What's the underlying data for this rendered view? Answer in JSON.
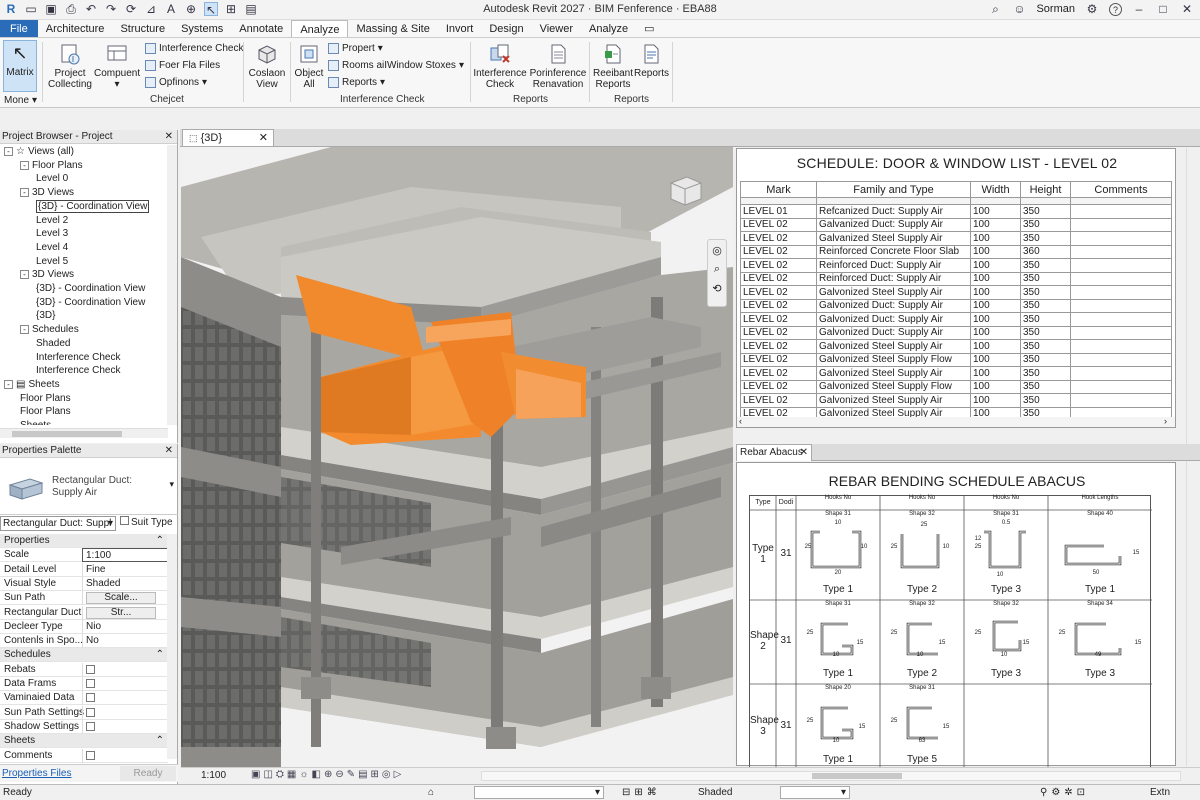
{
  "titlebar": {
    "title": "Autodesk Revit 2027 · BIM Fenference · EBA88",
    "user": "Sorman",
    "help": "?"
  },
  "menu": [
    "File",
    "Architecture",
    "Structure",
    "Systems",
    "Annotate",
    "Analyze",
    "Massing & Site",
    "Invort",
    "Design",
    "Viewer",
    "Analyze"
  ],
  "ribbon": {
    "matrix": "Matrix",
    "more": "Mone",
    "project_collecting": [
      "Project",
      "Collecting"
    ],
    "component": "Compuent",
    "interference_check_small": "Interference Check",
    "foer_fla_files": "Foer Fla Files",
    "options": "Opfinons",
    "coslaon_view": [
      "Coslaon",
      "View"
    ],
    "object_all": [
      "Object",
      "All"
    ],
    "propert": "Propert",
    "rooms": "Rooms aiIWindow Stoxes",
    "reports_small": "Reports",
    "interference_check_big": [
      "Interference",
      "Check"
    ],
    "porinference": [
      "Porinference",
      "Renavation"
    ],
    "reeibant_reports": [
      "Reeibant",
      "Reports"
    ],
    "reports_big": "Reports",
    "groups": [
      "Chejcet",
      "Interference Check",
      "Reports",
      "Reports"
    ]
  },
  "browser": {
    "header": "Project Browser - Project",
    "items": [
      {
        "label": "Views (all)",
        "indent": 0,
        "tog": "-"
      },
      {
        "label": "Floor Plans",
        "indent": 1,
        "tog": "-"
      },
      {
        "label": "Level 0",
        "indent": 2
      },
      {
        "label": "3D Views",
        "indent": 1,
        "tog": "-"
      },
      {
        "label": "{3D} - Coordination View",
        "indent": 2,
        "sel": true
      },
      {
        "label": "Level 2",
        "indent": 2
      },
      {
        "label": "Level 3",
        "indent": 2
      },
      {
        "label": "Level 4",
        "indent": 2
      },
      {
        "label": "Level 5",
        "indent": 2
      },
      {
        "label": "3D Views",
        "indent": 1,
        "tog": "-"
      },
      {
        "label": "{3D} - Coordination View",
        "indent": 2
      },
      {
        "label": "{3D} - Coordination View",
        "indent": 2
      },
      {
        "label": "{3D}",
        "indent": 2
      },
      {
        "label": "Schedules",
        "indent": 1,
        "tog": "-"
      },
      {
        "label": "Shaded",
        "indent": 2
      },
      {
        "label": "Interference Check",
        "indent": 2
      },
      {
        "label": "Interference Check",
        "indent": 2
      },
      {
        "label": "Sheets",
        "indent": 0,
        "tog": "-"
      },
      {
        "label": "Floor Plans",
        "indent": 1
      },
      {
        "label": "Floor Plans",
        "indent": 1
      },
      {
        "label": "Sheets",
        "indent": 1
      }
    ]
  },
  "properties": {
    "header": "Properties Palette",
    "type_name": [
      "Rectangular Duct:",
      "Supply Air"
    ],
    "selector": "Rectangular Duct: Suppl",
    "edit_type": "Suit Type",
    "sections": {
      "properties": "Properties",
      "schedules": "Schedules",
      "sheets": "Sheets"
    },
    "rows": [
      {
        "k": "Scale",
        "v": "1:100"
      },
      {
        "k": "Detail Level",
        "v": "Fine"
      },
      {
        "k": "Visual Style",
        "v": "Shaded"
      },
      {
        "k": "Sun Path",
        "v": "Scale..."
      },
      {
        "k": "Rectangular Duct",
        "v": "Str..."
      },
      {
        "k": "Decleer Type",
        "v": "Nio"
      },
      {
        "k": "Contenls in Spo...",
        "v": "No"
      }
    ],
    "schedule_rows": [
      "Rebats",
      "Data Frams",
      "Vaminaied Data",
      "Sun Path Settings",
      "Shadow Settings"
    ],
    "sheet_rows": [
      "Comments"
    ],
    "footer_link": "Properties Files",
    "footer_btn": "Ready"
  },
  "viewtab": {
    "label": "{3D}"
  },
  "schedule1": {
    "title": "SCHEDULE: DOOR & WINDOW LIST - LEVEL 02",
    "headers": [
      "Mark",
      "Family and Type",
      "Width",
      "Height",
      "Comments"
    ],
    "rows": [
      [
        "LEVEL 01",
        "Refcanized Duct: Supply Air",
        "100",
        "350",
        ""
      ],
      [
        "LEVEL 02",
        "Galvanized Duct: Supply Air",
        "100",
        "350",
        ""
      ],
      [
        "LEVEL 02",
        "Galvanized Steel Supply Air",
        "100",
        "350",
        ""
      ],
      [
        "LEVEL 02",
        "Reinforced Concrete Floor Slab",
        "100",
        "360",
        ""
      ],
      [
        "LEVEL 02",
        "Reinforced Duct: Supply Air",
        "100",
        "350",
        ""
      ],
      [
        "LEVEL 02",
        "Reinforced Duct: Supply Air",
        "100",
        "350",
        ""
      ],
      [
        "LEVEL 02",
        "Galvonized Steel Supply Air",
        "100",
        "350",
        ""
      ],
      [
        "LEVEL 02",
        "Galvonized Duct: Supply Air",
        "100",
        "350",
        ""
      ],
      [
        "LEVEL 02",
        "Galvonized Duct: Supply Air",
        "100",
        "350",
        ""
      ],
      [
        "LEVEL 02",
        "Galvonized Duct: Supply Air",
        "100",
        "350",
        ""
      ],
      [
        "LEVEL 02",
        "Galvonized Steel Supply Air",
        "100",
        "350",
        ""
      ],
      [
        "LEVEL 02",
        "Galvonized Steel Supply Flow",
        "100",
        "350",
        ""
      ],
      [
        "LEVEL 02",
        "Galvonized Steel Supply Air",
        "100",
        "350",
        ""
      ],
      [
        "LEVEL 02",
        "Galvonized Steel Supply Flow",
        "100",
        "350",
        ""
      ],
      [
        "LEVEL 02",
        "Galvonized Steel Supply Air",
        "100",
        "350",
        ""
      ],
      [
        "LEVEL 02",
        "Galvonized Steel Supply Air",
        "100",
        "350",
        ""
      ]
    ]
  },
  "schedule2": {
    "tab": "Rebar Abacus",
    "title": "REBAR BENDING SCHEDULE ABACUS",
    "headers": {
      "type": "Type",
      "dodi": "Dodi",
      "hooks1": "Hooks No",
      "hooks2": "Hooks No",
      "hooks3": "Hooks No",
      "hooklen": "Hook Lengths"
    },
    "rows": [
      {
        "label": [
          "Type",
          "1"
        ],
        "num": "31",
        "cells": [
          {
            "shape": "Shape 31",
            "type": "Type 1"
          },
          {
            "shape": "Shape 32",
            "type": "Type 2"
          },
          {
            "shape": "Shape 31",
            "type": "Type 3"
          },
          {
            "shape": "Shape 40",
            "type": "Type 1"
          }
        ]
      },
      {
        "label": [
          "Shape",
          "2"
        ],
        "num": "31",
        "cells": [
          {
            "shape": "Shape 31",
            "type": "Type 1"
          },
          {
            "shape": "Shape 32",
            "type": "Type 2"
          },
          {
            "shape": "Shape 32",
            "type": "Type 3"
          },
          {
            "shape": "Shape 34",
            "type": "Type 3"
          }
        ]
      },
      {
        "label": [
          "Shape",
          "3"
        ],
        "num": "31",
        "cells": [
          {
            "shape": "Shape 20",
            "type": "Type 1"
          },
          {
            "shape": "Shape 31",
            "type": "Type 5"
          }
        ]
      }
    ],
    "dims": [
      "10",
      "25",
      "10",
      "20",
      "25",
      "25",
      "10",
      "0.5",
      "25",
      "10",
      "12",
      "50",
      "15",
      "25",
      "15",
      "10",
      "25",
      "15",
      "10",
      "25",
      "15",
      "10",
      "25",
      "49",
      "15",
      "25",
      "15",
      "10",
      "25",
      "63",
      "15"
    ]
  },
  "viewcontrol": {
    "scale": "1:100"
  },
  "status": {
    "left": "Ready",
    "mid": "Shaded",
    "right": "Extn"
  }
}
